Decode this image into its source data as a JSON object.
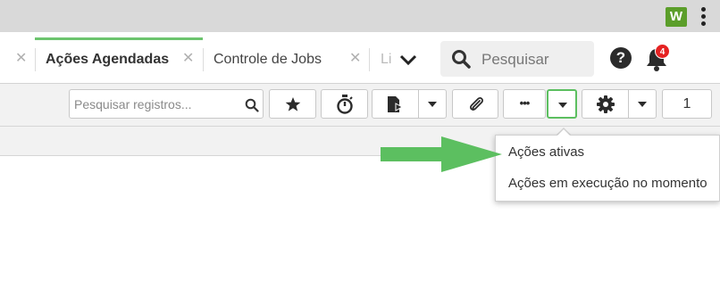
{
  "browser": {
    "extension_icon_label": "W",
    "extension_icon_color": "#5b9e2a"
  },
  "tabs": [
    {
      "label": "Ações Agendadas",
      "active": true
    },
    {
      "label": "Controle de Jobs",
      "active": false
    },
    {
      "label": "Li",
      "active": false
    }
  ],
  "accent_color": "#6cc46e",
  "header": {
    "search_placeholder": "Pesquisar",
    "help_label": "?",
    "notification_count": "4"
  },
  "toolbar": {
    "records_search_placeholder": "Pesquisar registros...",
    "more_label": "•••",
    "page_number": "1"
  },
  "dropdown_menu": {
    "items": [
      "Ações ativas",
      "Ações em execução no momento"
    ]
  },
  "icons": [
    "close-icon",
    "chevron-down-icon",
    "search-icon",
    "help-icon",
    "bell-icon",
    "star-icon",
    "stopwatch-icon",
    "export-document-icon",
    "paperclip-icon",
    "more-icon",
    "caret-down-icon",
    "gear-icon",
    "kebab-menu-icon"
  ]
}
